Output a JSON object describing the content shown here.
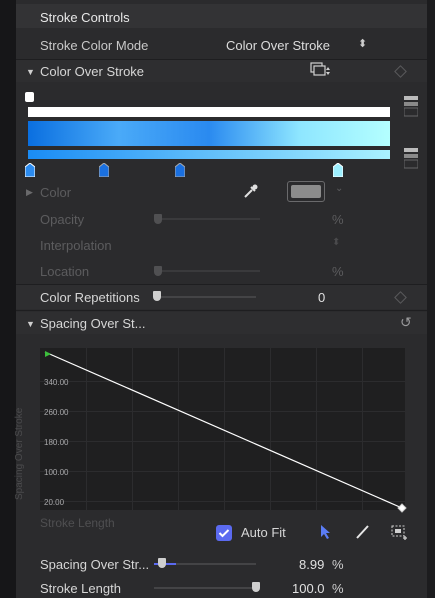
{
  "section_title": "Stroke Controls",
  "stroke_color_mode": {
    "label": "Stroke Color Mode",
    "value": "Color Over Stroke"
  },
  "color_over_stroke": {
    "title": "Color Over Stroke"
  },
  "gradient": {
    "top_bar_color": "#ffffff",
    "main_stops": [
      "#0a6fe0",
      "#4aaaf8",
      "#2a8af0",
      "#8ee6ff",
      "#b4ffff"
    ],
    "lower_stops": [
      "#1a8cf5",
      "#aaf2ff"
    ]
  },
  "color": {
    "label": "Color",
    "swatch": "#8c8c8c"
  },
  "opacity": {
    "label": "Opacity",
    "unit": "%"
  },
  "interpolation": {
    "label": "Interpolation"
  },
  "location": {
    "label": "Location",
    "unit": "%"
  },
  "color_repetitions": {
    "label": "Color Repetitions",
    "value": "0"
  },
  "spacing_over_stroke": {
    "title": "Spacing Over St..."
  },
  "chart_data": {
    "type": "line",
    "ylabel": "Spacing Over Stroke",
    "xlabel": "Stroke Length",
    "y_ticks": [
      "340.00",
      "260.00",
      "180.00",
      "100.00",
      "20.00"
    ],
    "line_start_color": "#3cbf3c",
    "line_color": "#ffffff"
  },
  "auto_fit": {
    "label": "Auto Fit",
    "checked": true
  },
  "icons": {
    "pointer": "arrow-cursor-icon",
    "pen": "pen-icon",
    "fit": "fit-frame-icon"
  },
  "spacing_param": {
    "label": "Spacing Over Str...",
    "value": "8.99",
    "unit": "%",
    "level": 0.06
  },
  "stroke_length_param": {
    "label": "Stroke Length",
    "value": "100.0",
    "unit": "%",
    "level": 1.0
  },
  "accent": "#5b6af0"
}
